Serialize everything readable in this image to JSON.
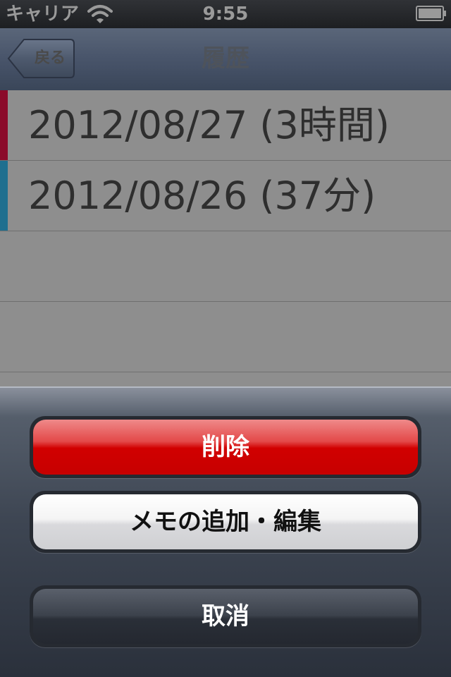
{
  "status_bar": {
    "carrier": "キャリア",
    "time": "9:55"
  },
  "nav": {
    "back_label": "戻る",
    "title": "履歴"
  },
  "history": [
    {
      "label": "2012/08/27 (3時間)",
      "color": "#8b0a2a"
    },
    {
      "label": "2012/08/26 (37分)",
      "color": "#1f6f8f"
    }
  ],
  "action_sheet": {
    "delete_label": "削除",
    "memo_label": "メモの追加・編集",
    "cancel_label": "取消"
  },
  "colors": {
    "delete_accent": "#d10000",
    "nav_bar": "#48546a"
  }
}
